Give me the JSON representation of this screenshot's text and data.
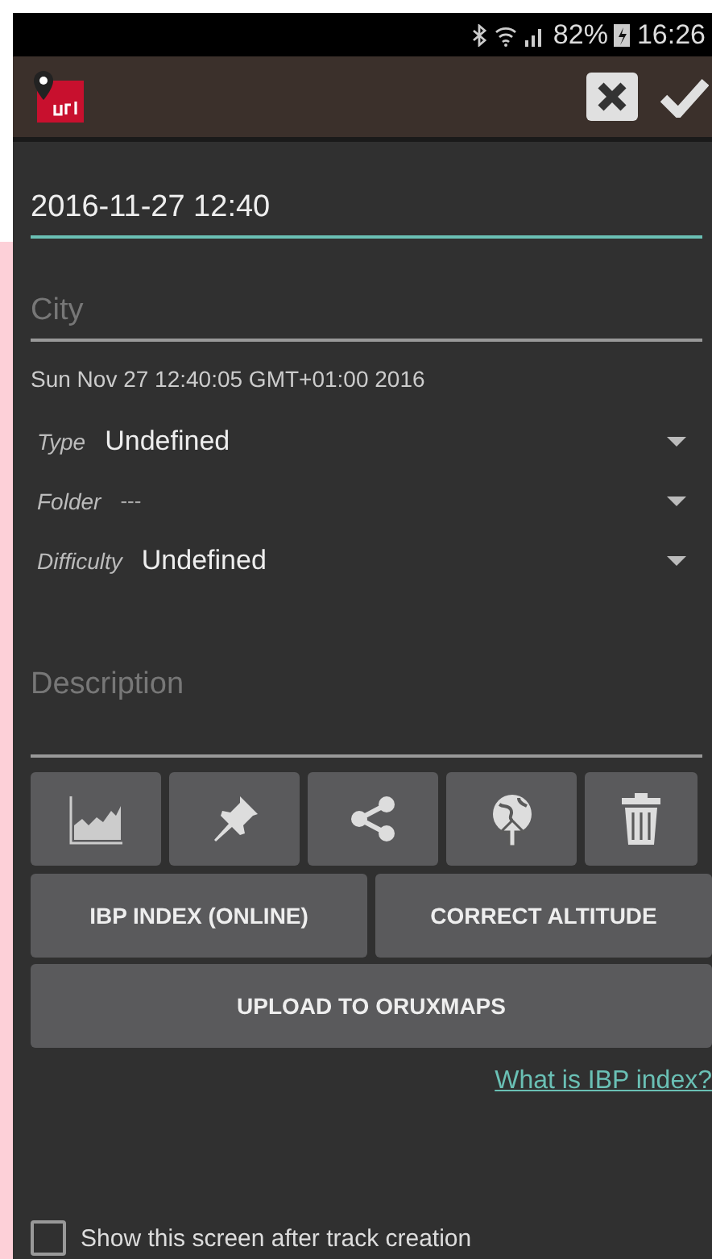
{
  "status_bar": {
    "battery": "82%",
    "time": "16:26"
  },
  "toolbar": {
    "actions": [
      {
        "kind": "cancel"
      },
      {
        "kind": "confirm"
      }
    ]
  },
  "name_field": {
    "value": "2016-11-27 12:40",
    "focused": true
  },
  "city_field": {
    "placeholder": "City",
    "focused": false
  },
  "date_text": "Sun Nov 27 12:40:05 GMT+01:00 2016",
  "spinners": [
    {
      "label": "Type",
      "value": "Undefined",
      "kind": "value"
    },
    {
      "label": "Folder",
      "value": "---",
      "kind": "empty"
    },
    {
      "label": "Difficulty",
      "value": "Undefined",
      "kind": "value"
    }
  ],
  "description_field": {
    "placeholder": "Description",
    "focused": false
  },
  "icon_buttons": [
    {
      "kind": "chart"
    },
    {
      "kind": "pin"
    },
    {
      "kind": "share"
    },
    {
      "kind": "globe"
    },
    {
      "kind": "trash"
    }
  ],
  "buttons": [
    {
      "label": "IBP INDEX (ONLINE)"
    },
    {
      "label": "CORRECT ALTITUDE"
    }
  ],
  "upload_button": {
    "label": "UPLOAD TO ORUXMAPS"
  },
  "link": "What is IBP index?",
  "checkbox": {
    "label": "Show this screen after track creation",
    "checked": false
  }
}
